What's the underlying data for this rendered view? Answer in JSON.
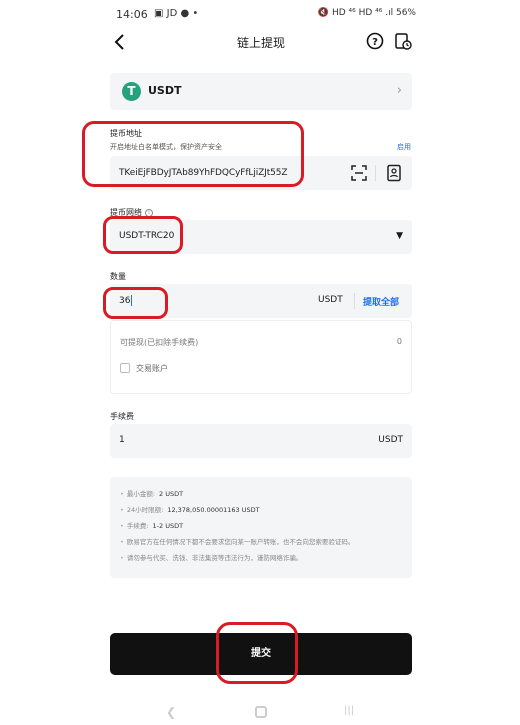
{
  "status_bar": {
    "time": "14:06",
    "apps": "▣ JD ● •",
    "system": "🔇 HD ⁴⁶ HD ⁴⁶ .ıl 56%"
  },
  "header": {
    "title": "链上提现"
  },
  "coin": {
    "symbol": "T",
    "name": "USDT",
    "color": "#26a17b"
  },
  "address": {
    "label": "提币地址",
    "hint": "开启地址白名单模式，保护资产安全",
    "enable_link": "启用",
    "value": "TKeiEjFBDyJTAb89YhFDQCyFfLjiZJt55Z"
  },
  "network": {
    "label": "提币网络",
    "info": "i",
    "value": "USDT-TRC20",
    "dropdown": "▼"
  },
  "amount": {
    "label": "数量",
    "value": "36",
    "unit": "USDT",
    "max_label": "提取全部",
    "available_label": "可提现(已扣除手续费)",
    "available_value": "0",
    "trade_account_label": "交易账户"
  },
  "fee": {
    "label": "手续费",
    "value": "1",
    "unit": "USDT"
  },
  "notes": [
    {
      "label": "最小金额:",
      "value": "2 USDT"
    },
    {
      "label": "24小时限额:",
      "value": "12,378,050.00001163 USDT"
    },
    {
      "label": "手续费:",
      "value": "1-2 USDT"
    },
    {
      "label": "欧易官方在任何情况下都不会要求您向某一账户转账，也不会向您索要验证码。",
      "value": ""
    },
    {
      "label": "请勿参与代买、洗钱、非法集资等违法行为，谨防网络诈骗。",
      "value": ""
    }
  ],
  "submit_label": "提交",
  "markup_color": "#d81b24"
}
